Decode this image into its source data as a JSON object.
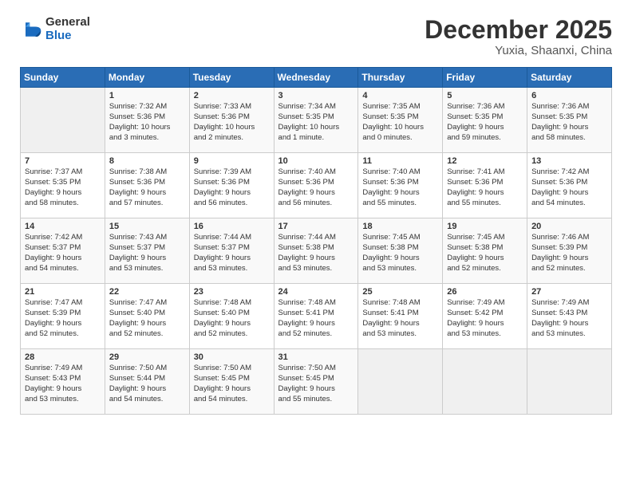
{
  "logo": {
    "general": "General",
    "blue": "Blue"
  },
  "title": "December 2025",
  "location": "Yuxia, Shaanxi, China",
  "days_header": [
    "Sunday",
    "Monday",
    "Tuesday",
    "Wednesday",
    "Thursday",
    "Friday",
    "Saturday"
  ],
  "weeks": [
    [
      {
        "day": "",
        "content": ""
      },
      {
        "day": "1",
        "content": "Sunrise: 7:32 AM\nSunset: 5:36 PM\nDaylight: 10 hours\nand 3 minutes."
      },
      {
        "day": "2",
        "content": "Sunrise: 7:33 AM\nSunset: 5:36 PM\nDaylight: 10 hours\nand 2 minutes."
      },
      {
        "day": "3",
        "content": "Sunrise: 7:34 AM\nSunset: 5:35 PM\nDaylight: 10 hours\nand 1 minute."
      },
      {
        "day": "4",
        "content": "Sunrise: 7:35 AM\nSunset: 5:35 PM\nDaylight: 10 hours\nand 0 minutes."
      },
      {
        "day": "5",
        "content": "Sunrise: 7:36 AM\nSunset: 5:35 PM\nDaylight: 9 hours\nand 59 minutes."
      },
      {
        "day": "6",
        "content": "Sunrise: 7:36 AM\nSunset: 5:35 PM\nDaylight: 9 hours\nand 58 minutes."
      }
    ],
    [
      {
        "day": "7",
        "content": "Sunrise: 7:37 AM\nSunset: 5:35 PM\nDaylight: 9 hours\nand 58 minutes."
      },
      {
        "day": "8",
        "content": "Sunrise: 7:38 AM\nSunset: 5:36 PM\nDaylight: 9 hours\nand 57 minutes."
      },
      {
        "day": "9",
        "content": "Sunrise: 7:39 AM\nSunset: 5:36 PM\nDaylight: 9 hours\nand 56 minutes."
      },
      {
        "day": "10",
        "content": "Sunrise: 7:40 AM\nSunset: 5:36 PM\nDaylight: 9 hours\nand 56 minutes."
      },
      {
        "day": "11",
        "content": "Sunrise: 7:40 AM\nSunset: 5:36 PM\nDaylight: 9 hours\nand 55 minutes."
      },
      {
        "day": "12",
        "content": "Sunrise: 7:41 AM\nSunset: 5:36 PM\nDaylight: 9 hours\nand 55 minutes."
      },
      {
        "day": "13",
        "content": "Sunrise: 7:42 AM\nSunset: 5:36 PM\nDaylight: 9 hours\nand 54 minutes."
      }
    ],
    [
      {
        "day": "14",
        "content": "Sunrise: 7:42 AM\nSunset: 5:37 PM\nDaylight: 9 hours\nand 54 minutes."
      },
      {
        "day": "15",
        "content": "Sunrise: 7:43 AM\nSunset: 5:37 PM\nDaylight: 9 hours\nand 53 minutes."
      },
      {
        "day": "16",
        "content": "Sunrise: 7:44 AM\nSunset: 5:37 PM\nDaylight: 9 hours\nand 53 minutes."
      },
      {
        "day": "17",
        "content": "Sunrise: 7:44 AM\nSunset: 5:38 PM\nDaylight: 9 hours\nand 53 minutes."
      },
      {
        "day": "18",
        "content": "Sunrise: 7:45 AM\nSunset: 5:38 PM\nDaylight: 9 hours\nand 53 minutes."
      },
      {
        "day": "19",
        "content": "Sunrise: 7:45 AM\nSunset: 5:38 PM\nDaylight: 9 hours\nand 52 minutes."
      },
      {
        "day": "20",
        "content": "Sunrise: 7:46 AM\nSunset: 5:39 PM\nDaylight: 9 hours\nand 52 minutes."
      }
    ],
    [
      {
        "day": "21",
        "content": "Sunrise: 7:47 AM\nSunset: 5:39 PM\nDaylight: 9 hours\nand 52 minutes."
      },
      {
        "day": "22",
        "content": "Sunrise: 7:47 AM\nSunset: 5:40 PM\nDaylight: 9 hours\nand 52 minutes."
      },
      {
        "day": "23",
        "content": "Sunrise: 7:48 AM\nSunset: 5:40 PM\nDaylight: 9 hours\nand 52 minutes."
      },
      {
        "day": "24",
        "content": "Sunrise: 7:48 AM\nSunset: 5:41 PM\nDaylight: 9 hours\nand 52 minutes."
      },
      {
        "day": "25",
        "content": "Sunrise: 7:48 AM\nSunset: 5:41 PM\nDaylight: 9 hours\nand 53 minutes."
      },
      {
        "day": "26",
        "content": "Sunrise: 7:49 AM\nSunset: 5:42 PM\nDaylight: 9 hours\nand 53 minutes."
      },
      {
        "day": "27",
        "content": "Sunrise: 7:49 AM\nSunset: 5:43 PM\nDaylight: 9 hours\nand 53 minutes."
      }
    ],
    [
      {
        "day": "28",
        "content": "Sunrise: 7:49 AM\nSunset: 5:43 PM\nDaylight: 9 hours\nand 53 minutes."
      },
      {
        "day": "29",
        "content": "Sunrise: 7:50 AM\nSunset: 5:44 PM\nDaylight: 9 hours\nand 54 minutes."
      },
      {
        "day": "30",
        "content": "Sunrise: 7:50 AM\nSunset: 5:45 PM\nDaylight: 9 hours\nand 54 minutes."
      },
      {
        "day": "31",
        "content": "Sunrise: 7:50 AM\nSunset: 5:45 PM\nDaylight: 9 hours\nand 55 minutes."
      },
      {
        "day": "",
        "content": ""
      },
      {
        "day": "",
        "content": ""
      },
      {
        "day": "",
        "content": ""
      }
    ]
  ]
}
